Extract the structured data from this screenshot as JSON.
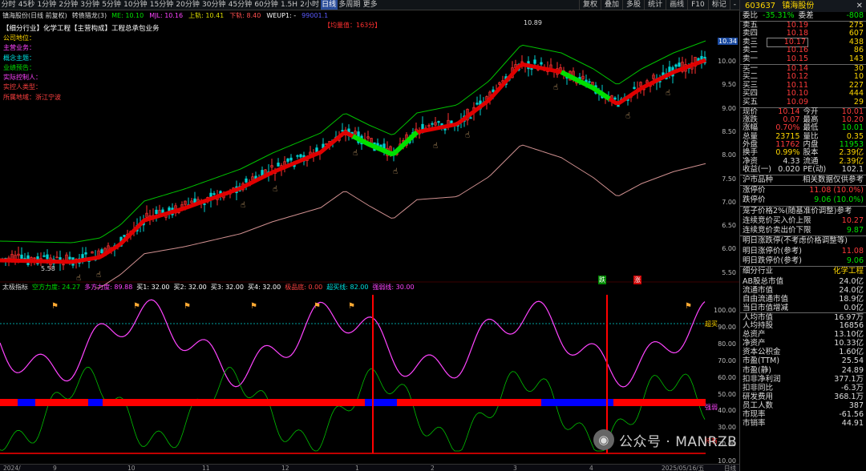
{
  "topbar": {
    "tabs": [
      "分时",
      "45秒",
      "1分钟",
      "2分钟",
      "3分钟",
      "5分钟",
      "10分钟",
      "15分钟",
      "20分钟",
      "30分钟",
      "45分钟",
      "60分钟",
      "1.5H",
      "2小时",
      "日线",
      "多周期",
      "更多"
    ],
    "active_tab": "日线",
    "right": [
      "复权",
      "叠加",
      "多股",
      "统计",
      "画线",
      "F10",
      "标记",
      "-"
    ]
  },
  "chart": {
    "name": "镇海股份(日线 前复权)",
    "ind": "转债猎龙(3)",
    "ma": [
      {
        "t": "ME: 10.10",
        "c": "#00e000"
      },
      {
        "t": "MJL: 10.16",
        "c": "#ff44ff"
      },
      {
        "t": "上轨: 10.41",
        "c": "#dddd00"
      },
      {
        "t": "下轨: 8.40",
        "c": "#ff5050"
      },
      {
        "t": "WEUP1: -",
        "c": "#ffffff"
      },
      {
        "t": "99001.1",
        "c": "#5a5aff"
      }
    ],
    "industry_line": "【细分行业】化学工程【主营构成】工程总承包业务",
    "cats": [
      {
        "t": "公司地位：",
        "c": "#ffd700"
      },
      {
        "t": "主营业务：",
        "c": "#ff44ff"
      },
      {
        "t": "概念主题：",
        "c": "#00e0e0"
      },
      {
        "t": "业绩预告：",
        "c": "#00e000"
      },
      {
        "t": "实际控制人：",
        "c": "#ff44ff"
      },
      {
        "t": "实控人类型：",
        "c": "#ff4040"
      },
      {
        "t": "所属地域：浙江宁波",
        "c": "#ff4040"
      }
    ],
    "hint": "【均量值：163分】",
    "hi": "10.89",
    "lo": "5.58",
    "cur": "10.34",
    "yaxis": [
      "10.00",
      "9.50",
      "9.00",
      "8.50",
      "8.00",
      "7.50",
      "7.00",
      "6.50",
      "6.00",
      "5.50"
    ],
    "tag_up": "跌",
    "tag_dn": "涨"
  },
  "ind": {
    "name": "太极指标",
    "items": [
      {
        "t": "空方力度: 24.27",
        "c": "#00e000"
      },
      {
        "t": "多方力度: 89.88",
        "c": "#ff44ff"
      },
      {
        "t": "买1: 32.00",
        "c": "#ffffff"
      },
      {
        "t": "买2: 32.00",
        "c": "#ffffff"
      },
      {
        "t": "买3: 32.00",
        "c": "#ffffff"
      },
      {
        "t": "买4: 32.00",
        "c": "#ffffff"
      },
      {
        "t": "极品底: 0.00",
        "c": "#ff4040"
      },
      {
        "t": "超买线: 82.00",
        "c": "#00e0e0"
      },
      {
        "t": "强弱线: 30.00",
        "c": "#ff44ff"
      }
    ],
    "yaxis": [
      "100.00",
      "90.00",
      "80.00",
      "70.00",
      "60.00",
      "50.00",
      "40.00",
      "30.00",
      "20.00",
      "10.00"
    ],
    "lbl_buy": "超买",
    "lbl_weak": "强弱",
    "lbl_hold": "持有"
  },
  "dates": [
    "2024/",
    "9",
    "10",
    "11",
    "12",
    "1",
    "2",
    "3",
    "4",
    "2025/05/16/五",
    "日线"
  ],
  "rp": {
    "code": "603637",
    "name": "镇海股份",
    "wb": {
      "l1": "委比",
      "v1": "-35.31%",
      "l2": "委差",
      "v2": "-808"
    },
    "asks": [
      [
        "卖五",
        "10.19",
        "275"
      ],
      [
        "卖四",
        "10.18",
        "607"
      ],
      [
        "卖三",
        "10.17",
        "438"
      ],
      [
        "卖二",
        "10.16",
        "86"
      ],
      [
        "卖一",
        "10.15",
        "143"
      ]
    ],
    "bids": [
      [
        "买一",
        "10.14",
        "30"
      ],
      [
        "买二",
        "10.12",
        "10"
      ],
      [
        "买三",
        "10.11",
        "227"
      ],
      [
        "买四",
        "10.10",
        "444"
      ],
      [
        "买五",
        "10.09",
        "29"
      ]
    ],
    "q": [
      [
        "现价",
        "10.14",
        "今开",
        "10.01"
      ],
      [
        "涨跌",
        "0.07",
        "最高",
        "10.20"
      ],
      [
        "涨幅",
        "0.70%",
        "最低",
        "10.01"
      ],
      [
        "总量",
        "23715",
        "量比",
        "0.35"
      ],
      [
        "外盘",
        "11762",
        "内盘",
        "11953"
      ],
      [
        "换手",
        "0.99%",
        "股本",
        "2.39亿"
      ],
      [
        "净资",
        "4.33",
        "流通",
        "2.39亿"
      ],
      [
        "收益(一)",
        "0.020",
        "PE(动)",
        "102.1"
      ]
    ],
    "sec1": {
      "l": "沪市品种",
      "r": "相关数据仅供参考"
    },
    "lim": [
      [
        "涨停价",
        "11.08 (10.0%)"
      ],
      [
        "跌停价",
        "9.06 (10.0%)"
      ]
    ],
    "cage": [
      [
        "笼子价格2%(随基准价调整)参考",
        ""
      ],
      [
        "连续竞价买入价上限",
        "10.27"
      ],
      [
        "连续竞价卖出价下限",
        "9.87"
      ]
    ],
    "nd": [
      [
        "明日涨跌停(不考虑价格调整等)",
        ""
      ],
      [
        "明日涨停价(参考)",
        "11.08"
      ],
      [
        "明日跌停价(参考)",
        "9.06"
      ]
    ],
    "fin_hdr": {
      "l": "细分行业",
      "r": "化学工程"
    },
    "fin": [
      [
        "AB股总市值",
        "24.0亿"
      ],
      [
        "流通市值",
        "24.0亿"
      ],
      [
        "自由流通市值",
        "18.9亿"
      ],
      [
        "当日市值增减",
        "0.0亿"
      ],
      [
        "人均市值",
        "16.97万"
      ],
      [
        "人均持股",
        "16856"
      ],
      [
        "总资产",
        "13.10亿"
      ],
      [
        "净资产",
        "10.33亿"
      ],
      [
        "资本公积金",
        "1.60亿"
      ],
      [
        "市盈(TTM)",
        "25.54"
      ],
      [
        "市盈(静)",
        "24.89"
      ],
      [
        "扣非净利润",
        "377.1万"
      ],
      [
        "扣非同比",
        "-6.3万"
      ],
      [
        "研发费用",
        "368.1万"
      ],
      [
        "员工人数",
        "387"
      ],
      [
        "市现率",
        "-61.56"
      ],
      [
        "市销率",
        "44.91"
      ]
    ]
  },
  "watermark": "公众号 · MANRZB"
}
